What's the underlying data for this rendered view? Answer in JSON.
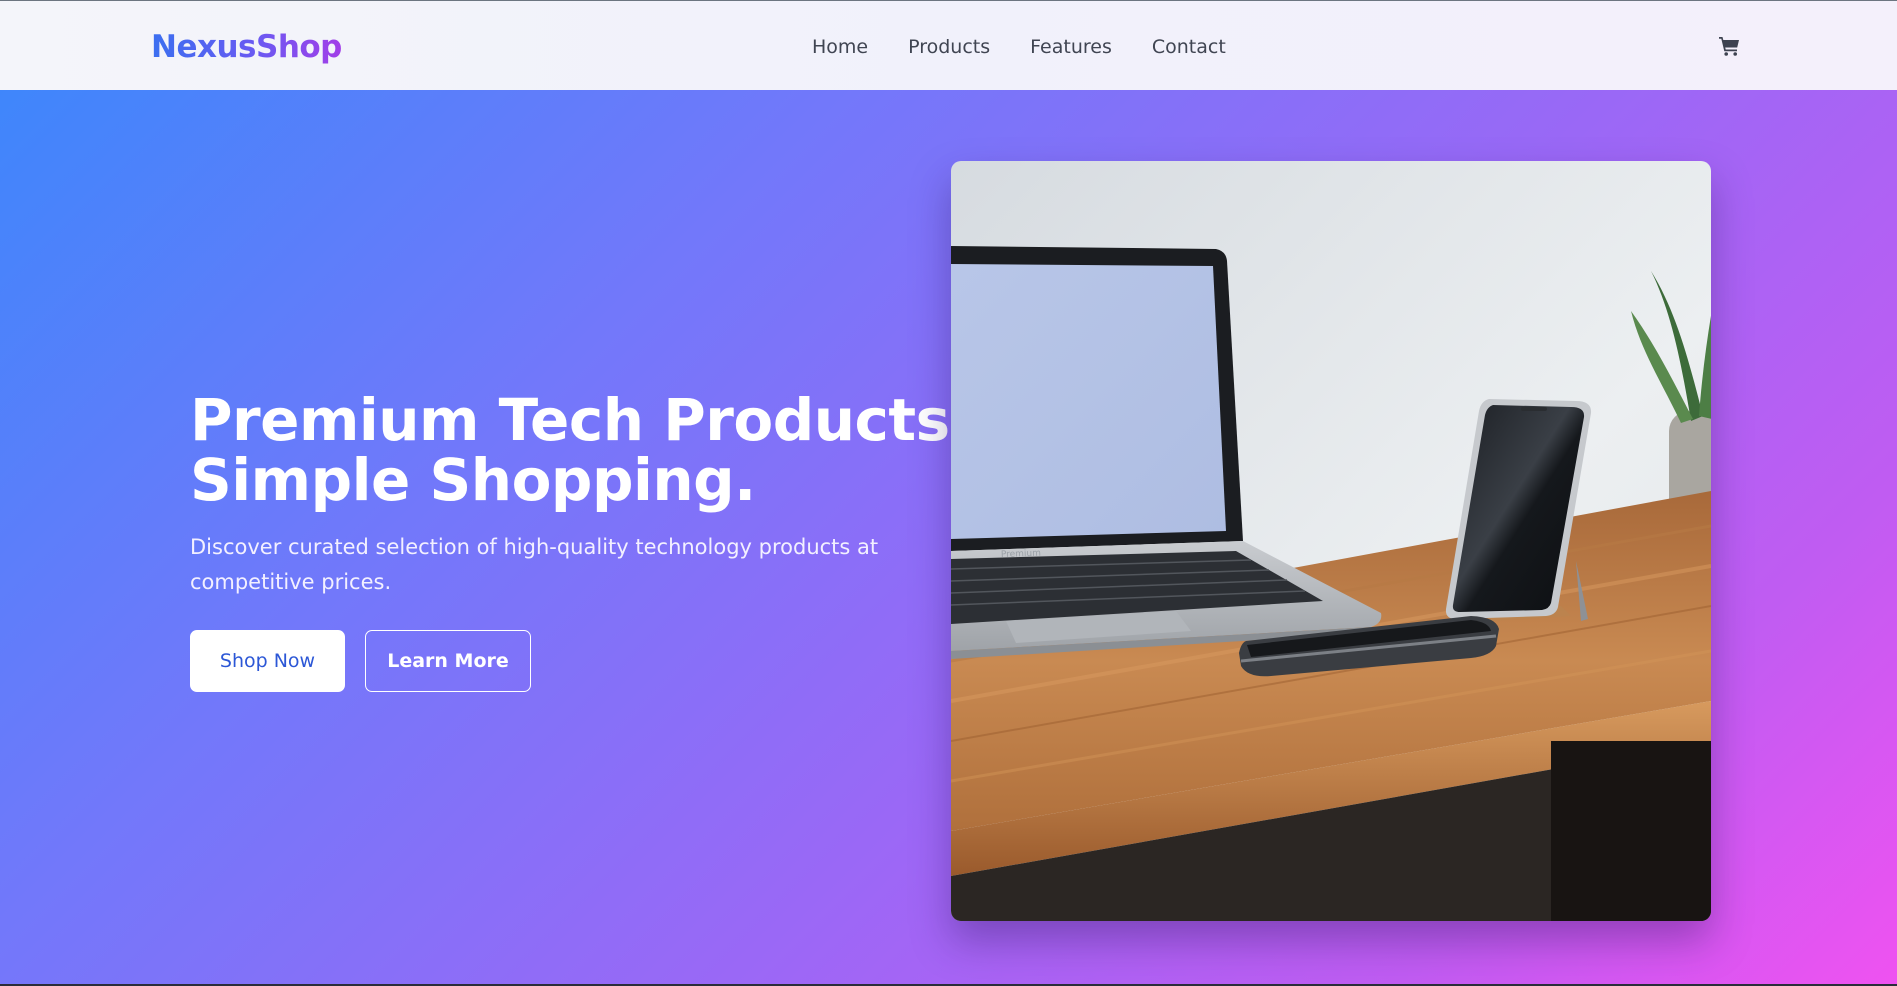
{
  "brand": {
    "name": "NexusShop"
  },
  "nav": {
    "items": [
      {
        "label": "Home"
      },
      {
        "label": "Products"
      },
      {
        "label": "Features"
      },
      {
        "label": "Contact"
      }
    ],
    "cart_icon": "shopping-cart-icon"
  },
  "hero": {
    "title_line1": "Premium Tech Products.",
    "title_line2": "Simple Shopping.",
    "subtitle": "Discover curated selection of high-quality technology products at competitive prices.",
    "primary_button": "Shop Now",
    "secondary_button": "Learn More",
    "image_keyboard_brand": "Premium"
  },
  "colors": {
    "gradient_start": "#3f86fb",
    "gradient_mid": "#9a68f6",
    "gradient_end": "#ef52f1",
    "primary_text": "#2c57d6"
  }
}
